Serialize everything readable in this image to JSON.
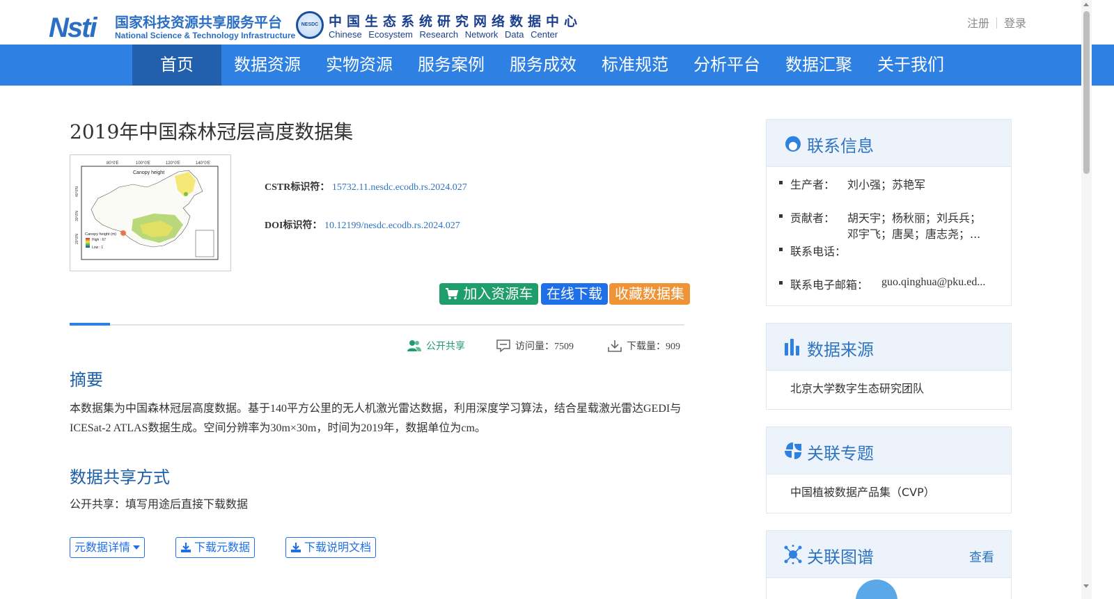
{
  "header": {
    "nsti_logo_mark": "Nsti",
    "nsti_cn": "国家科技资源共享服务平台",
    "nsti_en": "National Science & Technology Infrastructure",
    "nesdc_badge": "NESDC",
    "nesdc_cn": "中国生态系统研究网络数据中心",
    "nesdc_en": "Chinese Ecosystem Research Network Data Center",
    "register": "注册",
    "login": "登录"
  },
  "nav": {
    "items": [
      "首页",
      "数据资源",
      "实物资源",
      "服务案例",
      "服务成效",
      "标准规范",
      "分析平台",
      "数据汇聚",
      "关于我们"
    ],
    "active_index": 0
  },
  "dataset": {
    "title": "2019年中国森林冠层高度数据集",
    "thumbnail": {
      "map_title": "Canopy height",
      "lon_ticks": [
        "80°0'E",
        "100°0'E",
        "120°0'E",
        "140°0'E"
      ],
      "lat_ticks": [
        "40°0'N",
        "30°0'N",
        "20°0'N"
      ],
      "legend_title": "Canopy height (m)",
      "legend_high": "High : 67",
      "legend_low": "Low : 1"
    },
    "cstr_label": "CSTR标识符：",
    "cstr_value": "15732.11.nesdc.ecodb.rs.2024.027",
    "doi_label": "DOI标识符：",
    "doi_value": "10.12199/nesdc.ecodb.rs.2024.027",
    "buttons": {
      "add_cart": "加入资源车",
      "download_online": "在线下载",
      "favorite": "收藏数据集"
    },
    "stats": {
      "share": "公开共享",
      "visits": "访问量：7509",
      "downloads": "下载量：909"
    },
    "abstract_heading": "摘要",
    "abstract_text": "本数据集为中国森林冠层高度数据。基于140平方公里的无人机激光雷达数据，利用深度学习算法，结合星载激光雷达GEDI与ICESat-2 ATLAS数据生成。空间分辨率为30m×30m，时间为2019年，数据单位为cm。",
    "share_heading": "数据共享方式",
    "share_text": "公开共享：填写用途后直接下载数据",
    "actions": {
      "metadata_detail": "元数据详情",
      "download_metadata": "下载元数据",
      "download_doc": "下载说明文档"
    }
  },
  "sidebar": {
    "contact": {
      "title": "联系信息",
      "producer_label": "生产者：",
      "producer_value": "刘小强；苏艳军",
      "contributor_label": "贡献者：",
      "contributor_line1": "胡天宇；杨秋丽；刘兵兵；",
      "contributor_line2": "邓宇飞；唐昊；唐志尧；...",
      "phone_label": "联系电话：",
      "email_label": "联系电子邮箱：",
      "email_value": "guo.qinghua@pku.ed..."
    },
    "source": {
      "title": "数据来源",
      "value": "北京大学数字生态研究团队"
    },
    "topic": {
      "title": "关联专题",
      "value": "中国植被数据产品集（CVP）"
    },
    "graph": {
      "title": "关联图谱",
      "view": "查看"
    }
  },
  "colors": {
    "nav_bg": "#2f80e3",
    "nav_active": "#225fad",
    "heading_blue": "#1a5fa8",
    "btn_green": "#1f9e6b",
    "btn_blue": "#1e6fe8",
    "btn_orange": "#ee9437"
  }
}
